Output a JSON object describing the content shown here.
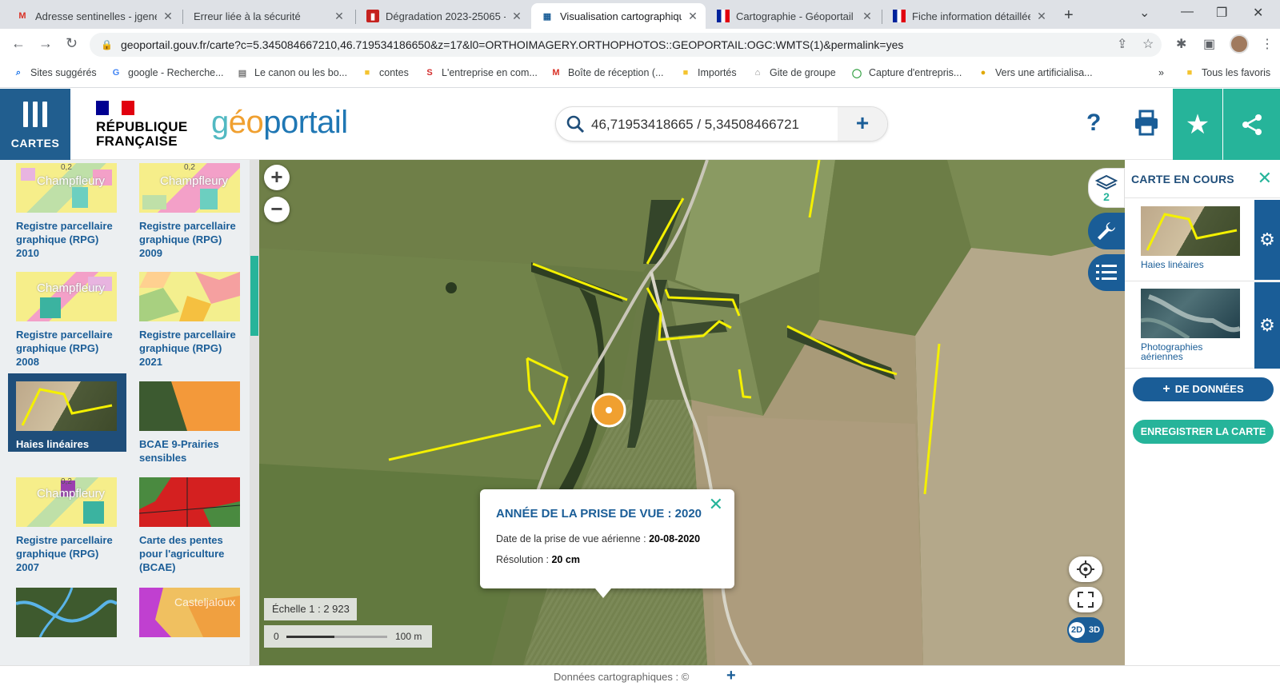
{
  "browser": {
    "tabs": [
      {
        "label": "Adresse sentinelles - jgenev",
        "favicon": "gmail-icon",
        "active": false
      },
      {
        "label": "Erreur liée à la sécurité",
        "favicon": "none",
        "active": false
      },
      {
        "label": "Dégradation 2023-25065 -",
        "favicon": "doc-icon",
        "active": false
      },
      {
        "label": "Visualisation cartographiqu",
        "favicon": "gov-icon",
        "active": true
      },
      {
        "label": "Cartographie - Géoportail d",
        "favicon": "marianne-icon",
        "active": false
      },
      {
        "label": "Fiche information détaillée",
        "favicon": "marianne-icon",
        "active": false
      }
    ],
    "url": "geoportail.gouv.fr/carte?c=5.345084667210,46.719534186650&z=17&l0=ORTHOIMAGERY.ORTHOPHOTOS::GEOPORTAIL:OGC:WMTS(1)&permalink=yes",
    "bookmarks": [
      {
        "label": "Sites suggérés"
      },
      {
        "label": "google - Recherche..."
      },
      {
        "label": "Le canon ou les bo..."
      },
      {
        "label": "contes"
      },
      {
        "label": "L'entreprise en com..."
      },
      {
        "label": "Boîte de réception (..."
      },
      {
        "label": "Importés"
      },
      {
        "label": "Gite de groupe"
      },
      {
        "label": "Capture d'entrepris..."
      },
      {
        "label": "Vers une artificialisa..."
      }
    ],
    "bookmarks_more": "»",
    "all_bookmarks": "Tous les favoris"
  },
  "header": {
    "cartes_label": "CARTES",
    "rf_line1": "RÉPUBLIQUE",
    "rf_line2": "FRANÇAISE",
    "logo_part1": "g",
    "logo_part2": "éo",
    "logo_part3": "portail",
    "search_value": "46,71953418665 / 5,34508466721",
    "help_label": "?",
    "colors": {
      "primary": "#1a5d97",
      "accent": "#26b49a",
      "dark": "#1f4e7a"
    }
  },
  "catalog": {
    "items": [
      {
        "label": "Registre parcellaire graphique (RPG) 2010",
        "thumb_text": "Champfleury",
        "thumb_num": "0,2",
        "selected": false
      },
      {
        "label": "Registre parcellaire graphique (RPG) 2009",
        "thumb_text": "Champfleury",
        "thumb_num": "0,2",
        "selected": false
      },
      {
        "label": "Registre parcellaire graphique (RPG) 2008",
        "thumb_text": "Champfleury",
        "selected": false
      },
      {
        "label": "Registre parcellaire graphique (RPG) 2021",
        "selected": false
      },
      {
        "label": "Haies linéaires",
        "selected": true
      },
      {
        "label": "BCAE 9-Prairies sensibles",
        "selected": false
      },
      {
        "label": "Registre parcellaire graphique (RPG) 2007",
        "thumb_text": "Champfleury",
        "thumb_num": "0,2",
        "selected": false
      },
      {
        "label": "Carte des pentes pour l'agriculture (BCAE)",
        "selected": false
      },
      {
        "label": "",
        "selected": false
      },
      {
        "label": "",
        "thumb_text": "Casteljaloux",
        "selected": false
      }
    ]
  },
  "map": {
    "popup": {
      "title": "ANNÉE DE LA PRISE DE VUE : 2020",
      "date_label": "Date de la prise de vue aérienne : ",
      "date_value": "20-08-2020",
      "res_label": "Résolution : ",
      "res_value": "20 cm"
    },
    "scale_label": "Échelle 1 : 2 923",
    "scale_zero": "0",
    "scale_max": "100 m",
    "btn_2d": "2D",
    "btn_3d": "3D",
    "layer_count": "2"
  },
  "mappanel": {
    "title": "CARTE EN COURS",
    "layers": [
      {
        "name": "Haies linéaires"
      },
      {
        "name": "Photographies aériennes"
      }
    ],
    "add_data": "DE DONNÉES",
    "add_data_plus": "+",
    "save_map": "ENREGISTRER LA CARTE"
  },
  "footer": {
    "text": "Données cartographiques : ©",
    "plus": "+"
  }
}
